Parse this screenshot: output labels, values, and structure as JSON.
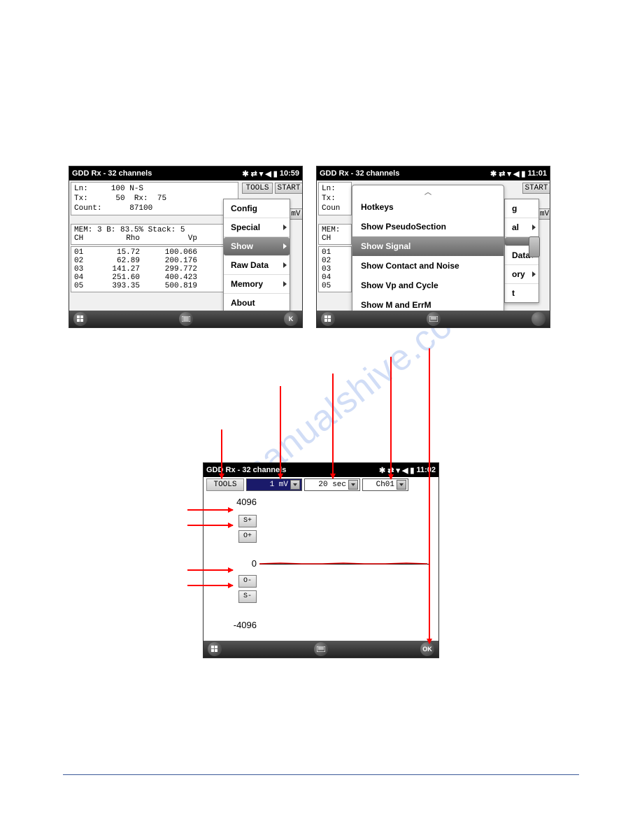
{
  "watermark": "manualshive.com",
  "screen1": {
    "title": "GDD Rx - 32 channels",
    "clock": "10:59",
    "info": {
      "ln_label": "Ln:",
      "ln_value": "100 N-S",
      "tx_label": "Tx:",
      "tx_value": "50",
      "rx_label": "Rx:",
      "rx_value": "75",
      "count_label": "Count:",
      "count_value": "87100"
    },
    "mem_line": "MEM: 3 B: 83.5% Stack: 5",
    "table": {
      "h1": "CH",
      "h2": "Rho",
      "h3": "Vp",
      "rows": [
        {
          "ch": "01",
          "rho": "15.72",
          "vp": "100.066"
        },
        {
          "ch": "02",
          "rho": "62.89",
          "vp": "200.176"
        },
        {
          "ch": "03",
          "rho": "141.27",
          "vp": "299.772"
        },
        {
          "ch": "04",
          "rho": "251.60",
          "vp": "400.423"
        },
        {
          "ch": "05",
          "rho": "393.35",
          "vp": "500.819"
        }
      ]
    },
    "tools_btn": "TOOLS",
    "start_btn": "START",
    "mv_btn": "mV",
    "menu": {
      "config": "Config",
      "special": "Special",
      "show": "Show",
      "raw_data": "Raw Data",
      "memory": "Memory",
      "about": "About"
    },
    "ok_btn": "K"
  },
  "screen2": {
    "title": "GDD Rx - 32 channels",
    "clock": "11:01",
    "info": {
      "ln_label": "Ln:",
      "tx_label": "Tx:",
      "count_label": "Coun"
    },
    "mem_line_a": "MEM:",
    "mem_line_b": "CH",
    "rows": [
      "01",
      "02",
      "03",
      "04",
      "05"
    ],
    "start_btn": "START",
    "mv_btn": "mV",
    "menu_frag_g": "g",
    "menu_frag_al": "al",
    "menu_frag_data": "Data",
    "menu_frag_ory": "ory",
    "menu_frag_t": "t",
    "submenu": {
      "hotkeys": "Hotkeys",
      "pseudo": "Show PseudoSection",
      "signal": "Show Signal",
      "contact": "Show Contact and Noise",
      "vp": "Show Vp and Cycle",
      "merr": "Show M and ErrM"
    }
  },
  "screen3": {
    "title": "GDD Rx - 32 channels",
    "clock": "11:02",
    "tools_btn": "TOOLS",
    "dd_mv": "1 mV",
    "dd_sec": "20 sec",
    "dd_ch": "Ch01",
    "yvals": {
      "top": "4096",
      "mid": "0",
      "bot": "-4096"
    },
    "btns": {
      "splus": "S+",
      "oplus": "O+",
      "ominus": "O-",
      "sminus": "S-"
    },
    "ok_btn": "OK"
  },
  "chart_data": {
    "type": "line",
    "title": "",
    "xlabel": "",
    "ylabel": "",
    "ylim": [
      -4096,
      4096
    ],
    "series": [
      {
        "name": "Ch01",
        "values": [
          0,
          0,
          0,
          0,
          0,
          0,
          0,
          0,
          0,
          0
        ]
      }
    ]
  }
}
